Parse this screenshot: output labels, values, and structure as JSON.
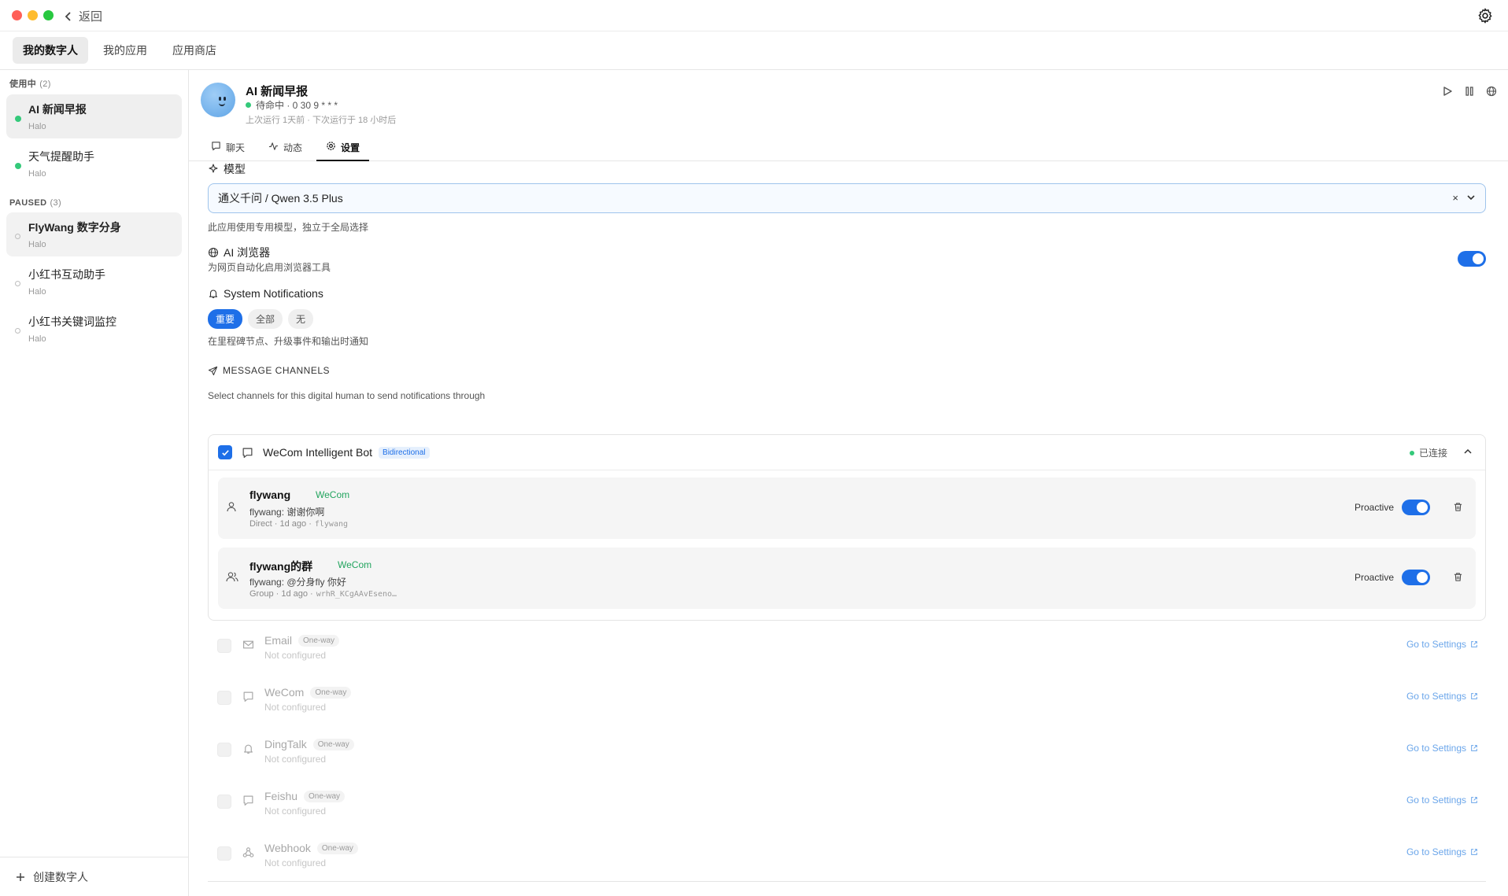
{
  "window": {
    "back_label": "返回",
    "traffic_colors": [
      "#ff5f57",
      "#febc2e",
      "#28c840"
    ]
  },
  "top_tabs": [
    {
      "label": "我的数字人",
      "active": true
    },
    {
      "label": "我的应用",
      "active": false
    },
    {
      "label": "应用商店",
      "active": false
    }
  ],
  "sidebar": {
    "active_section": {
      "label": "使用中",
      "count": "(2)"
    },
    "active_items": [
      {
        "name": "AI 新闻早报",
        "sub": "Halo"
      },
      {
        "name": "天气提醒助手",
        "sub": "Halo"
      }
    ],
    "paused_section": {
      "label": "PAUSED",
      "count": "(3)"
    },
    "paused_items": [
      {
        "name": "FlyWang 数字分身",
        "sub": "Halo"
      },
      {
        "name": "小红书互动助手",
        "sub": "Halo"
      },
      {
        "name": "小红书关键词监控",
        "sub": "Halo"
      }
    ],
    "create_label": "创建数字人"
  },
  "header": {
    "title": "AI 新闻早报",
    "status": "待命中 · 0 30 9 * * *",
    "meta": "上次运行 1天前 · 下次运行于 18 小时后"
  },
  "sub_tabs": [
    {
      "label": "聊天",
      "icon": "chat-icon"
    },
    {
      "label": "动态",
      "icon": "activity-icon"
    },
    {
      "label": "设置",
      "icon": "gear-icon",
      "active": true
    }
  ],
  "settings": {
    "model": {
      "title": "模型",
      "value": "通义千问 / Qwen 3.5 Plus",
      "clear": "×",
      "hint": "此应用使用专用模型，独立于全局选择"
    },
    "browser": {
      "title": "AI 浏览器",
      "hint": "为网页自动化启用浏览器工具",
      "enabled": true
    },
    "notifications": {
      "title": "System Notifications",
      "options": [
        "重要",
        "全部",
        "无"
      ],
      "selected": "重要",
      "hint": "在里程碑节点、升级事件和输出时通知"
    },
    "channels": {
      "title": "MESSAGE CHANNELS",
      "hint": "Select channels for this digital human to send notifications through",
      "connected": {
        "name": "WeCom Intelligent Bot",
        "badge": "Bidirectional",
        "status": "已连接",
        "contacts": [
          {
            "name": "flywang",
            "source": "WeCom",
            "message": "flywang: 谢谢你啊",
            "meta": "Direct · 1d ago ·",
            "id": "flywang",
            "proactive_label": "Proactive",
            "proactive": true
          },
          {
            "name": "flywang的群",
            "source": "WeCom",
            "message": "flywang: @分身fly 你好",
            "meta": "Group · 1d ago ·",
            "id": "wrhR_KCgAAvEseno…",
            "proactive_label": "Proactive",
            "proactive": true
          }
        ]
      },
      "others": [
        {
          "name": "Email",
          "badge": "One-way",
          "status": "Not configured",
          "action": "Go to Settings",
          "icon": "mail-icon"
        },
        {
          "name": "WeCom",
          "badge": "One-way",
          "status": "Not configured",
          "action": "Go to Settings",
          "icon": "chat-icon"
        },
        {
          "name": "DingTalk",
          "badge": "One-way",
          "status": "Not configured",
          "action": "Go to Settings",
          "icon": "bell-icon"
        },
        {
          "name": "Feishu",
          "badge": "One-way",
          "status": "Not configured",
          "action": "Go to Settings",
          "icon": "chat-icon"
        },
        {
          "name": "Webhook",
          "badge": "One-way",
          "status": "Not configured",
          "action": "Go to Settings",
          "icon": "webhook-icon"
        }
      ]
    }
  },
  "colors": {
    "accent": "#1e6fe8",
    "green": "#34c97a",
    "wecom_green": "#22a45e",
    "link": "#6ba6ea"
  }
}
